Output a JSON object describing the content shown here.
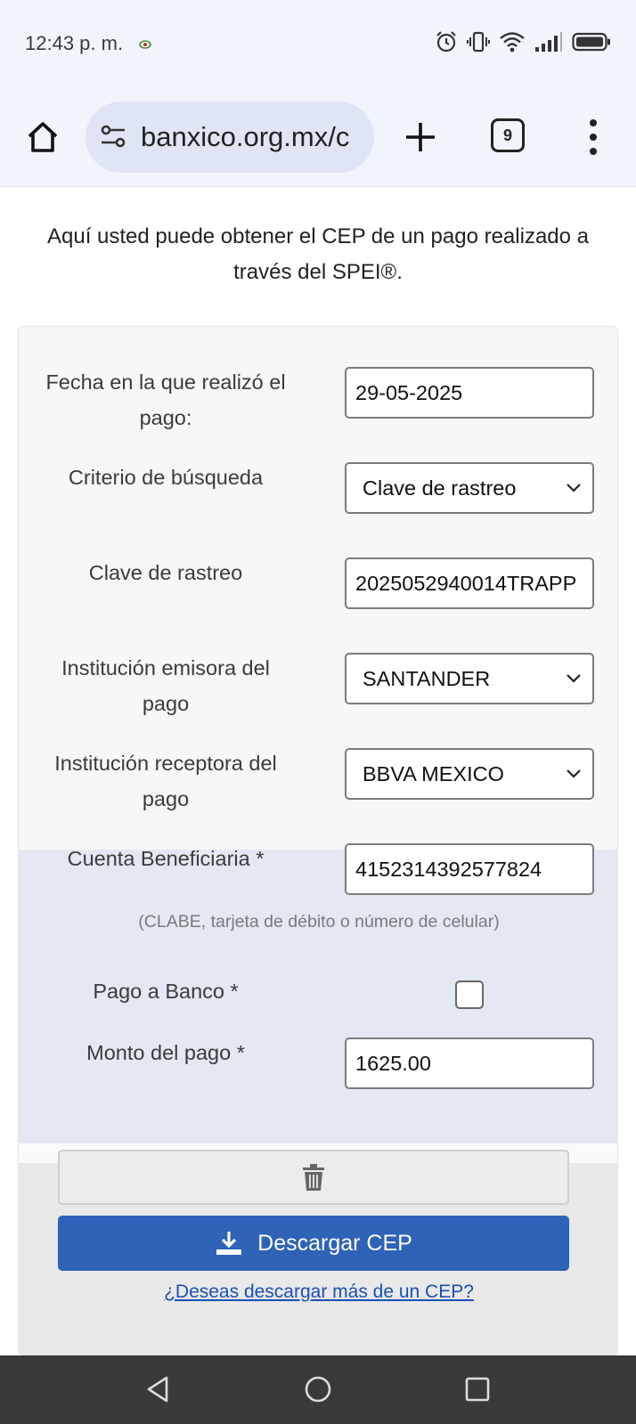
{
  "status_bar": {
    "time": "12:43 p. m."
  },
  "browser": {
    "url": "banxico.org.mx/c",
    "tab_count": "9"
  },
  "page": {
    "intro_line1": "Aquí usted puede obtener el CEP de un pago realizado a",
    "intro_line2": "través del SPEI®."
  },
  "form": {
    "fecha_label_1": "Fecha en la que realizó el",
    "fecha_label_2": "pago:",
    "fecha_value": "29-05-2025",
    "criterio_label": "Criterio de búsqueda",
    "criterio_value": "Clave de rastreo",
    "clave_label": "Clave de rastreo",
    "clave_value": "2025052940014TRAPP",
    "emisora_label_1": "Institución emisora del",
    "emisora_label_2": "pago",
    "emisora_value": "SANTANDER",
    "receptora_label_1": "Institución receptora del",
    "receptora_label_2": "pago",
    "receptora_value": "BBVA MEXICO",
    "cuenta_label": "Cuenta Beneficiaria *",
    "cuenta_value": "4152314392577824",
    "cuenta_hint": "(CLABE, tarjeta de débito o número de celular)",
    "pago_banco_label": "Pago a Banco *",
    "pago_banco_checked": false,
    "monto_label": "Monto del pago *",
    "monto_value": "1625.00"
  },
  "actions": {
    "download_label": "Descargar CEP",
    "more_link": "¿Deseas descargar más de un CEP?"
  },
  "icons": {
    "home": "home-icon",
    "tune": "site-settings-icon",
    "new_tab": "plus-icon",
    "menu": "more-vert-icon",
    "trash": "trash-icon",
    "download": "download-icon",
    "alarm": "alarm-icon",
    "vibrate": "vibrate-icon",
    "wifi": "wifi-icon",
    "signal": "signal-icon",
    "battery": "battery-icon"
  },
  "colors": {
    "primary_button": "#2e63b7",
    "link": "#1b4fb5",
    "highlight_section": "#e3e8f2"
  }
}
